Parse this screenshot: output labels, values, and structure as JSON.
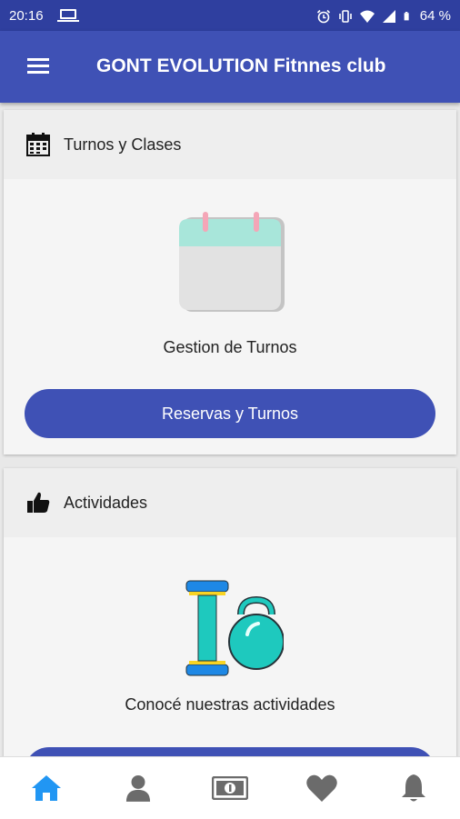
{
  "status_bar": {
    "time": "20:16",
    "battery": "64 %"
  },
  "app_bar": {
    "title": "GONT EVOLUTION Fitnnes club"
  },
  "cards": [
    {
      "header": "Turnos y Clases",
      "caption": "Gestion de Turnos",
      "button": "Reservas y Turnos"
    },
    {
      "header": "Actividades",
      "caption": "Conocé nuestras actividades"
    }
  ],
  "bottom_nav": {
    "items": [
      "home-icon",
      "profile-icon",
      "payment-icon",
      "favorites-icon",
      "notifications-icon"
    ]
  },
  "colors": {
    "primary": "#3f51b5",
    "status_bar": "#2f3f9f",
    "active_nav": "#2196f3",
    "inactive_nav": "#6b6b6b"
  }
}
